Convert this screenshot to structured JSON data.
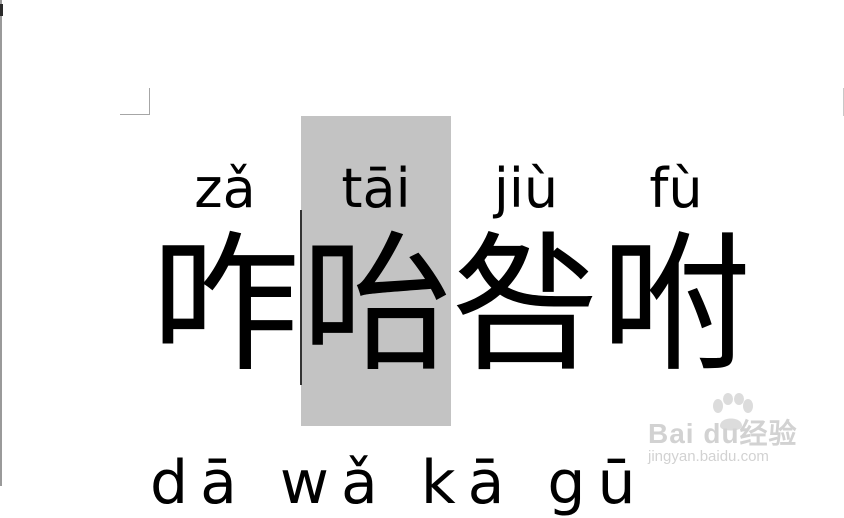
{
  "document": {
    "line1": {
      "pinyin": [
        "zǎ",
        "tāi",
        "jiù",
        "fù"
      ],
      "hanzi": [
        "咋",
        "咍",
        "咎",
        "咐"
      ]
    },
    "line2": {
      "pinyin": "dā wǎ kā gū"
    }
  },
  "watermark": {
    "logo_text": "Bai du经验",
    "url": "jingyan.baidu.com"
  },
  "colors": {
    "selection": "#c3c3c3",
    "text": "#000000",
    "watermark": "#d2d2d2"
  }
}
